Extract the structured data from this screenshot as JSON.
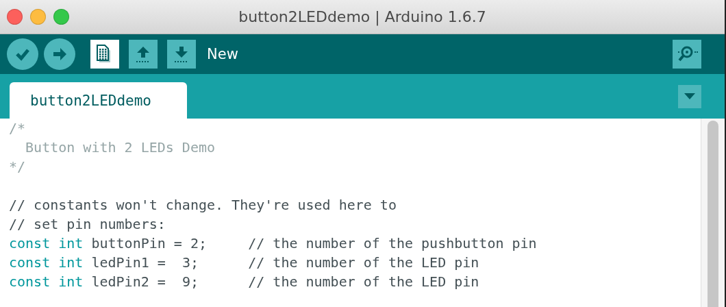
{
  "window": {
    "title": "button2LEDdemo | Arduino 1.6.7"
  },
  "toolbar": {
    "buttons": [
      {
        "kind": "verify",
        "selected": false
      },
      {
        "kind": "upload",
        "selected": false
      },
      {
        "kind": "new",
        "selected": true
      },
      {
        "kind": "open",
        "selected": false
      },
      {
        "kind": "save",
        "selected": false
      }
    ],
    "label": "New"
  },
  "tabs": [
    {
      "label": "button2LEDdemo",
      "selected": true
    }
  ],
  "editor": {
    "lines": [
      {
        "kind": "comment",
        "tokens": [
          {
            "kind": "comment",
            "text": "/*"
          }
        ]
      },
      {
        "kind": "comment",
        "tokens": [
          {
            "kind": "comment",
            "text": "  Button with 2 LEDs Demo"
          }
        ]
      },
      {
        "kind": "comment",
        "tokens": [
          {
            "kind": "comment",
            "text": "*/"
          }
        ]
      },
      {
        "kind": "blank"
      },
      {
        "kind": "code",
        "tokens": [
          {
            "kind": "plain",
            "text": "// constants won't change. They're used here to"
          }
        ]
      },
      {
        "kind": "code",
        "tokens": [
          {
            "kind": "plain",
            "text": "// set pin numbers:"
          }
        ]
      },
      {
        "kind": "code",
        "tokens": [
          {
            "kind": "keyword",
            "text": "const"
          },
          {
            "kind": "keyword",
            "text": " int"
          },
          {
            "kind": "plain",
            "text": " buttonPin = 2;     // the number of the pushbutton pin"
          }
        ]
      },
      {
        "kind": "code",
        "tokens": [
          {
            "kind": "keyword",
            "text": "const"
          },
          {
            "kind": "keyword",
            "text": " int"
          },
          {
            "kind": "plain",
            "text": " ledPin1 =  3;      // the number of the LED pin"
          }
        ]
      },
      {
        "kind": "code",
        "tokens": [
          {
            "kind": "keyword",
            "text": "const"
          },
          {
            "kind": "keyword",
            "text": " int"
          },
          {
            "kind": "plain",
            "text": " ledPin2 =  9;      // the number of the LED pin"
          }
        ]
      }
    ]
  }
}
